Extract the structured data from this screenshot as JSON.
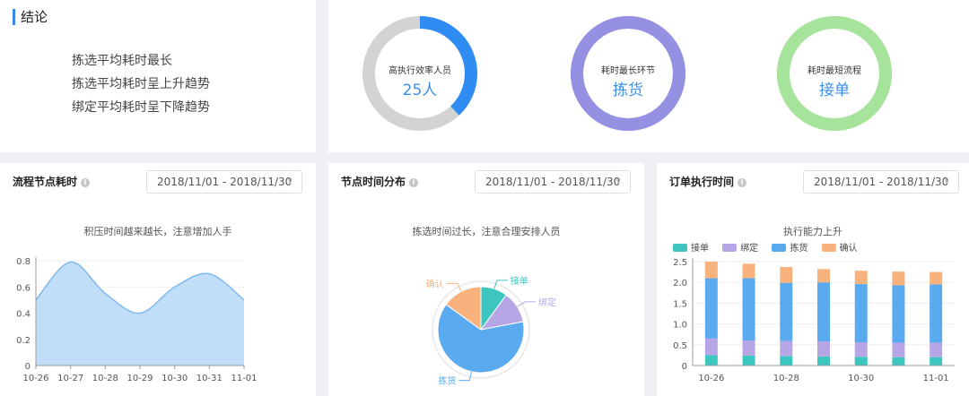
{
  "conclusion": {
    "title": "结论",
    "items": [
      "拣选平均耗时最长",
      "拣选平均耗时呈上升趋势",
      "绑定平均耗时呈下降趋势"
    ]
  },
  "summary": [
    {
      "label": "高执行效率人员",
      "value": "25人",
      "fill": 0.38,
      "color": "#2f8cf2",
      "track": "#d3d3d3"
    },
    {
      "label": "耗时最长环节",
      "value": "拣货",
      "fill": 1.0,
      "color": "#9590e2",
      "track": "#9590e2"
    },
    {
      "label": "耗时最短流程",
      "value": "接单",
      "fill": 1.0,
      "color": "#a6e39b",
      "track": "#a6e39b"
    }
  ],
  "flow_card": {
    "title": "流程节点耗时",
    "date_range": "2018/11/01 - 2018/11/30",
    "chart_title": "积压时间越来越长，注意增加人手"
  },
  "node_card": {
    "title": "节点时间分布",
    "date_range": "2018/11/01 - 2018/11/30",
    "chart_title": "拣选时间过长，注意合理安排人员"
  },
  "order_card": {
    "title": "订单执行时间",
    "date_range": "2018/11/01 - 2018/11/30",
    "chart_title": "执行能力上升"
  },
  "chart_data": [
    {
      "type": "area",
      "x": [
        "10-26",
        "10-27",
        "10-28",
        "10-29",
        "10-30",
        "10-31",
        "11-01"
      ],
      "values": [
        0.5,
        0.79,
        0.55,
        0.4,
        0.6,
        0.7,
        0.5
      ],
      "ylim": [
        0,
        0.8
      ],
      "yticks": [
        "0",
        "0.2",
        "0.4",
        "0.6",
        "0.8"
      ],
      "color": "#7fb9ee"
    },
    {
      "type": "pie",
      "slices": [
        {
          "name": "接单",
          "value": 10,
          "color": "#3cc6bf"
        },
        {
          "name": "绑定",
          "value": 12,
          "color": "#b6a6e6"
        },
        {
          "name": "拣货",
          "value": 63,
          "color": "#5aaaf0"
        },
        {
          "name": "确认",
          "value": 15,
          "color": "#f7b27e"
        }
      ]
    },
    {
      "type": "bar",
      "categories": [
        "10-26",
        "10-27",
        "10-28",
        "10-29",
        "10-30",
        "10-31",
        "11-01"
      ],
      "xticks": [
        "10-26",
        "10-28",
        "10-30",
        "11-01"
      ],
      "ylim": [
        0,
        2.5
      ],
      "yticks": [
        "0",
        "0.5",
        "1.0",
        "1.5",
        "2.0",
        "2.5"
      ],
      "series": [
        {
          "name": "接单",
          "color": "#3cc6bf",
          "values": [
            0.25,
            0.24,
            0.23,
            0.22,
            0.21,
            0.2,
            0.2
          ]
        },
        {
          "name": "绑定",
          "color": "#b6a6e6",
          "values": [
            0.4,
            0.36,
            0.36,
            0.36,
            0.35,
            0.35,
            0.35
          ]
        },
        {
          "name": "拣货",
          "color": "#5aaaf0",
          "values": [
            1.45,
            1.5,
            1.4,
            1.42,
            1.4,
            1.38,
            1.4
          ]
        },
        {
          "name": "确认",
          "color": "#f7b27e",
          "values": [
            0.4,
            0.35,
            0.38,
            0.32,
            0.32,
            0.33,
            0.3
          ]
        }
      ]
    }
  ]
}
